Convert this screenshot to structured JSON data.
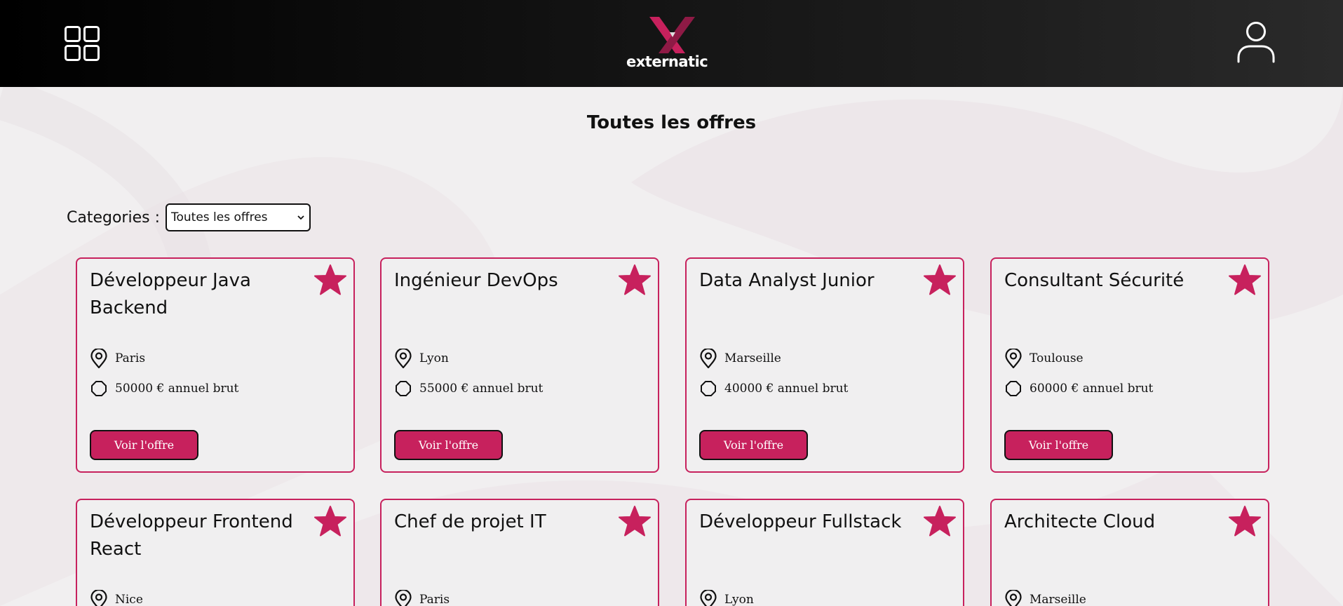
{
  "header": {
    "logo_text": "externatic",
    "colors": {
      "accent": "#c7215d",
      "header_bg": "#000000"
    }
  },
  "page": {
    "title": "Toutes les offres"
  },
  "filter": {
    "label": "Categories :",
    "selected": "Toutes les offres"
  },
  "offers": [
    {
      "title": "Développeur Java Backend",
      "location": "Paris",
      "salary": "50000 € annuel brut",
      "button": "Voir l'offre"
    },
    {
      "title": "Ingénieur DevOps",
      "location": "Lyon",
      "salary": "55000 € annuel brut",
      "button": "Voir l'offre"
    },
    {
      "title": "Data Analyst Junior",
      "location": "Marseille",
      "salary": "40000 € annuel brut",
      "button": "Voir l'offre"
    },
    {
      "title": "Consultant Sécurité",
      "location": "Toulouse",
      "salary": "60000 € annuel brut",
      "button": "Voir l'offre"
    },
    {
      "title": "Développeur Frontend React",
      "location": "Nice"
    },
    {
      "title": "Chef de projet IT",
      "location": "Paris"
    },
    {
      "title": "Développeur Fullstack",
      "location": "Lyon"
    },
    {
      "title": "Architecte Cloud",
      "location": "Marseille"
    }
  ]
}
